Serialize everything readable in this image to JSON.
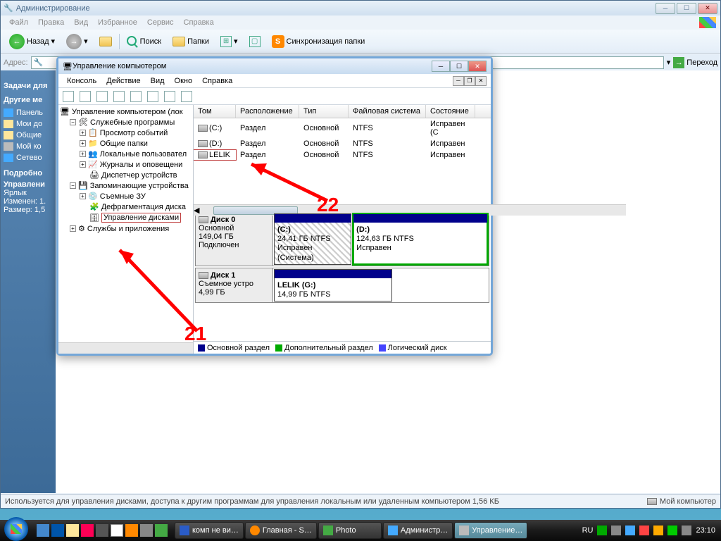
{
  "outer": {
    "title": "Администрирование",
    "menu": [
      "Файл",
      "Правка",
      "Вид",
      "Избранное",
      "Сервис",
      "Справка"
    ],
    "toolbar": {
      "back": "Назад",
      "search": "Поиск",
      "folders": "Папки",
      "sync": "Синхронизация папки"
    },
    "addr_label": "Адрес:",
    "go": "Переход"
  },
  "sidebar": {
    "h1": "Задачи для",
    "h2": "Другие ме",
    "items": [
      "Панель",
      "Мои до",
      "Общие",
      "Мой ко",
      "Сетево"
    ],
    "h3": "Подробно",
    "detail_name": "Управлени",
    "detail_type": "Ярлык",
    "detail_mod": "Изменен: 1.",
    "detail_size": "Размер: 1,5"
  },
  "mmc": {
    "title": "Управление компьютером",
    "menu": [
      "Консоль",
      "Действие",
      "Вид",
      "Окно",
      "Справка"
    ],
    "tree": {
      "root": "Управление компьютером (лок",
      "sys": "Служебные программы",
      "ev": "Просмотр событий",
      "sf": "Общие папки",
      "lu": "Локальные пользовател",
      "log": "Журналы и оповещени",
      "dm": "Диспетчер устройств",
      "stor": "Запоминающие устройства",
      "rem": "Съемные ЗУ",
      "defrag": "Дефрагментация диска",
      "diskm": "Управление дисками",
      "svc": "Службы и приложения"
    },
    "vol_head": [
      "Том",
      "Расположение",
      "Тип",
      "Файловая система",
      "Состояние"
    ],
    "volumes": [
      {
        "name": "(C:)",
        "layout": "Раздел",
        "type": "Основной",
        "fs": "NTFS",
        "status": "Исправен (С"
      },
      {
        "name": "(D:)",
        "layout": "Раздел",
        "type": "Основной",
        "fs": "NTFS",
        "status": "Исправен"
      },
      {
        "name": "LELIK",
        "layout": "Раздел",
        "type": "Основной",
        "fs": "NTFS",
        "status": "Исправен"
      }
    ],
    "disk0": {
      "name": "Диск 0",
      "type": "Основной",
      "size": "149,04 ГБ",
      "status": "Подключен"
    },
    "disk0_c": {
      "name": "(C:)",
      "size": "24,41 ГБ NTFS",
      "status": "Исправен (Система)"
    },
    "disk0_d": {
      "name": "(D:)",
      "size": "124,63 ГБ NTFS",
      "status": "Исправен"
    },
    "disk1": {
      "name": "Диск 1",
      "type": "Съемное устро",
      "size": "4,99 ГБ"
    },
    "disk1_g": {
      "name": "LELIK  (G:)",
      "size": "14,99 ГБ NTFS"
    },
    "legend": [
      "Основной раздел",
      "Дополнительный раздел",
      "Логический диск"
    ]
  },
  "annotations": {
    "n21": "21",
    "n22": "22"
  },
  "statusbar": {
    "text": "Используется для управления дисками, доступа к другим программам для управления локальным или удаленным компьютером 1,56 КБ",
    "right": "Мой компьютер"
  },
  "taskbar": {
    "items": [
      "комп не ви…",
      "Главная - S…",
      "Photo",
      "Администр…",
      "Управление…"
    ],
    "lang": "RU",
    "time": "23:10"
  }
}
